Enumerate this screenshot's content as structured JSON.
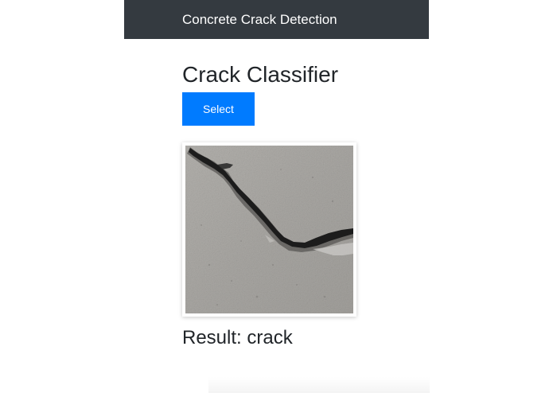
{
  "navbar": {
    "brand": "Concrete Crack Detection",
    "background": "#343a40"
  },
  "main": {
    "title": "Crack Classifier",
    "select_label": "Select",
    "accent": "#007bff",
    "result_label": "Result:",
    "result_value": "crack"
  },
  "image": {
    "alt": "concrete surface with crack"
  }
}
